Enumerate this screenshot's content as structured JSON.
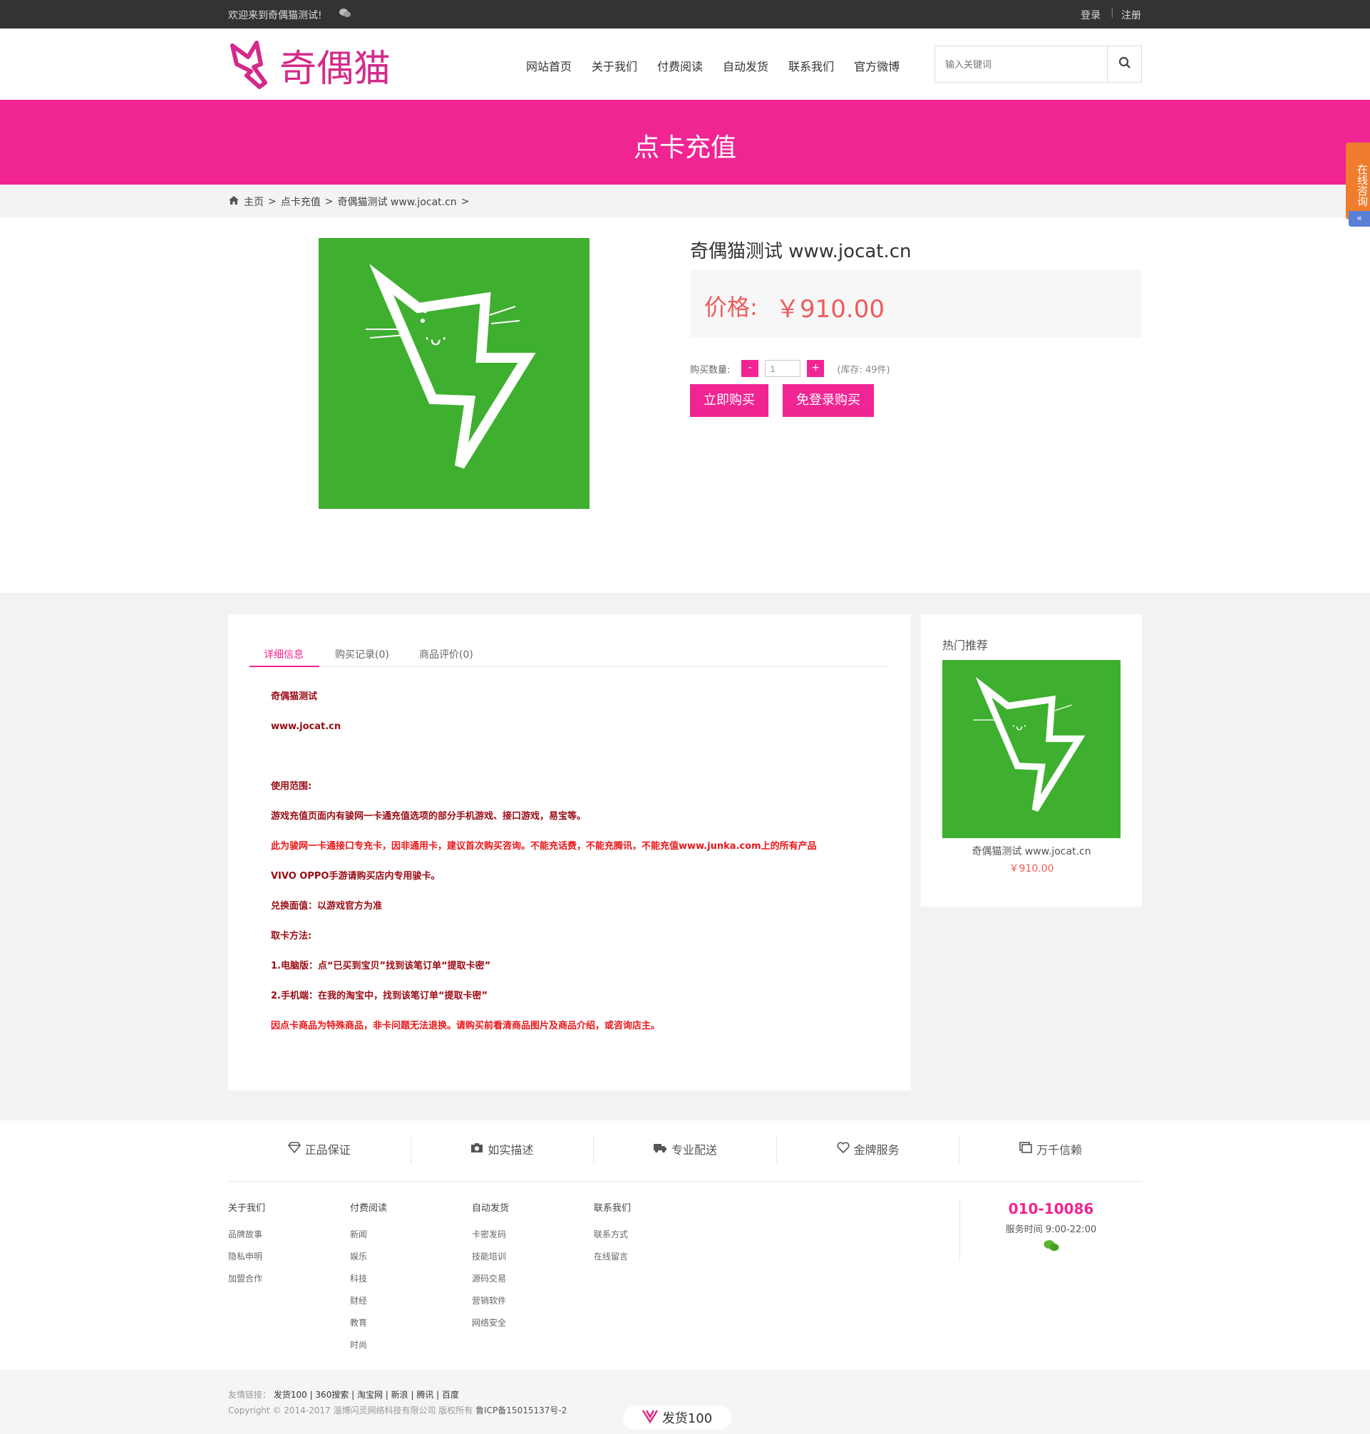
{
  "topbar": {
    "welcome": "欢迎来到奇偶猫测试!",
    "login": "登录",
    "separator": "|",
    "register": "注册"
  },
  "nav": {
    "items": [
      "网站首页",
      "关于我们",
      "付费阅读",
      "自动发货",
      "联系我们",
      "官方微博"
    ]
  },
  "search": {
    "placeholder": "输入关键词"
  },
  "banner": {
    "title": "点卡充值"
  },
  "breadcrumb": {
    "home": "主页",
    "category": "点卡充值",
    "current": "奇偶猫测试 www.jocat.cn",
    "sep": ">"
  },
  "product": {
    "title": "奇偶猫测试 www.jocat.cn",
    "price_label": "价格:",
    "price": "￥910.00",
    "qty_label": "购买数量:",
    "qty_minus": "-",
    "qty_value": "1",
    "qty_plus": "+",
    "stock": "(库存: 49件)",
    "buy_now": "立即购买",
    "guest_buy": "免登录购买"
  },
  "tabs": [
    "详细信息",
    "购买记录(0)",
    "商品评价(0)"
  ],
  "description": [
    {
      "text": "奇偶猫测试",
      "color": "darkred"
    },
    {
      "text": "www.jocat.cn",
      "color": "darkred"
    },
    {
      "text": "",
      "color": "darkred"
    },
    {
      "text": "使用范围:",
      "color": "darkred"
    },
    {
      "text": "游戏充值页面内有骏网一卡通充值选项的部分手机游戏、接口游戏，易宝等。",
      "color": "darkred"
    },
    {
      "text": "此为骏网一卡通接口专充卡，因非通用卡，建议首次购买咨询。不能充话费，不能充腾讯，不能充值www.junka.com上的所有产品",
      "color": "red"
    },
    {
      "text": "VIVO OPPO手游请购买店内专用骏卡。",
      "color": "darkred"
    },
    {
      "text": "兑换面值：以游戏官方为准",
      "color": "darkred"
    },
    {
      "text": "取卡方法:",
      "color": "darkred"
    },
    {
      "text": "1.电脑版：点“已买到宝贝”找到该笔订单“提取卡密”",
      "color": "darkred"
    },
    {
      "text": "2.手机端：在我的淘宝中，找到该笔订单“提取卡密”",
      "color": "darkred"
    },
    {
      "text": "因点卡商品为特殊商品，非卡问题无法退换。请购买前看清商品图片及商品介绍，或咨询店主。",
      "color": "red"
    }
  ],
  "sidebar": {
    "title": "热门推荐",
    "item_name": "奇偶猫测试 www.jocat.cn",
    "item_price": "￥910.00"
  },
  "features": [
    "正品保证",
    "如实描述",
    "专业配送",
    "金牌服务",
    "万千信赖"
  ],
  "footer_cols": [
    {
      "title": "关于我们",
      "items": [
        "品牌故事",
        "隐私申明",
        "加盟合作"
      ]
    },
    {
      "title": "付费阅读",
      "items": [
        "新闻",
        "娱乐",
        "科技",
        "财经",
        "教育",
        "时尚"
      ]
    },
    {
      "title": "自动发货",
      "items": [
        "卡密发码",
        "技能培训",
        "源码交易",
        "营销软件",
        "网络安全"
      ]
    },
    {
      "title": "联系我们",
      "items": [
        "联系方式",
        "在线留言"
      ]
    }
  ],
  "contact": {
    "phone": "010-10086",
    "hours": "服务时间 9:00-22:00"
  },
  "bottom": {
    "links_label": "友情链接：",
    "links": "发货100 | 360搜索 | 淘宝网 | 新浪 | 腾讯 | 百度",
    "copyright": "Copyright © 2014-2017 淄博闪灵网络科技有限公司 版权所有",
    "icp": "鲁ICP备15015137号-2",
    "badge": "发货100"
  },
  "online_chat": {
    "label": "在线咨询",
    "collapse": "«"
  },
  "colors": {
    "accent": "#f02593",
    "price": "#f05a5a",
    "product_bg": "#3faf2f",
    "topbar": "#333333"
  }
}
